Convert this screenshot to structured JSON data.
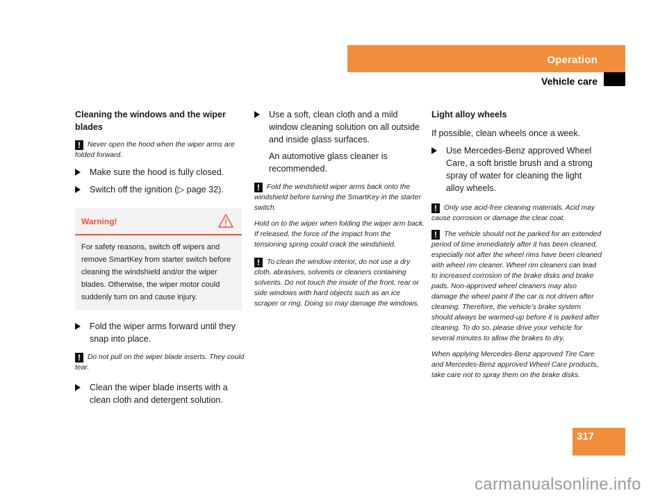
{
  "header": {
    "section": "Operation",
    "subtitle": "Vehicle care",
    "accent_color": "#f28d3c"
  },
  "col1": {
    "heading": "Cleaning the windows and the wiper blades",
    "note1": "Never open the hood when the wiper arms are folded forward.",
    "step1": "Make sure the hood is fully closed.",
    "step2": "Switch off the ignition (▷ page 32).",
    "warning": {
      "title": "Warning!",
      "icon": "warning-triangle-icon",
      "body": "For safety reasons, switch off wipers and remove SmartKey from starter switch before cleaning the windshield and/or the wiper blades. Otherwise, the wiper motor could suddenly turn on and cause injury.",
      "color": "#f04e3e"
    },
    "step3": "Fold the wiper arms forward until they snap into place.",
    "note2": "Do not pull on the wiper blade inserts. They could tear.",
    "step4": "Clean the wiper blade inserts with a clean cloth and detergent solution."
  },
  "col2": {
    "step1": "Use a soft, clean cloth and a mild window cleaning solution on all outside and inside glass surfaces.",
    "step1_sub": "An automotive glass cleaner is recommended.",
    "note1": "Fold the windshield wiper arms back onto the windshield before turning the SmartKey in the starter switch.",
    "note1_cont": "Hold on to the wiper when folding the wiper arm back. If released, the force of the impact from the tensioning spring could crack the windshield.",
    "note2": "To clean the window interior, do not use a dry cloth, abrasives, solvents or cleaners containing solvents. Do not touch the inside of the front, rear or side windows with hard objects such as an ice scraper or ring. Doing so may damage the windows."
  },
  "col3": {
    "heading": "Light alloy wheels",
    "intro": "If possible, clean wheels once a week.",
    "step1": "Use Mercedes-Benz approved Wheel Care, a soft bristle brush and a strong spray of water for cleaning the light alloy wheels.",
    "note1": "Only use acid-free cleaning materials. Acid may cause corrosion or damage the clear coat.",
    "note2": "The vehicle should not be parked for an extended period of time immediately after it has been cleaned, especially not after the wheel rims have been cleaned with wheel rim cleaner. Wheel rim cleaners can lead to increased corrosion of the brake disks and brake pads. Non-approved wheel cleaners may also damage the wheel paint if the car is not driven after cleaning. Therefore, the vehicle’s brake system should always be warmed-up before it is parked after cleaning. To do so, please drive your vehicle for several minutes to allow the brakes to dry.",
    "note2_cont": "When applying Mercedes-Benz approved Tire Care and Mercedes-Benz approved Wheel Care products, take care not to spray them on the brake disks."
  },
  "footer": {
    "page_number": "317",
    "watermark": "carmanualsonline.info"
  },
  "note_marker": "!"
}
